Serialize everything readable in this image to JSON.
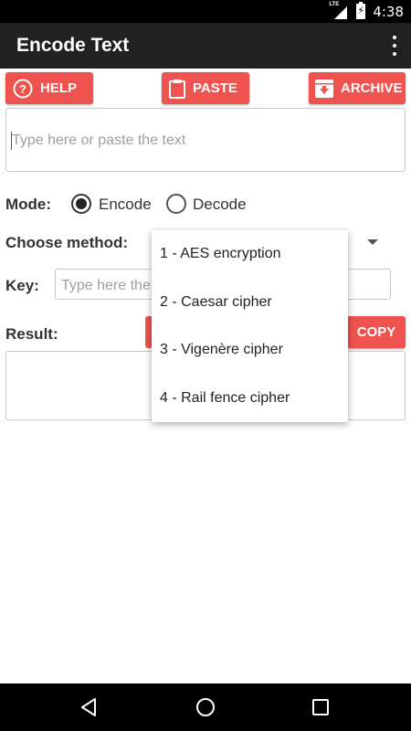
{
  "status_bar": {
    "time": "4:38",
    "network": "LTE"
  },
  "app_bar": {
    "title": "Encode Text"
  },
  "toolbar": {
    "help_label": "HELP",
    "paste_label": "PASTE",
    "archive_label": "ARCHIVE"
  },
  "input": {
    "placeholder": "Type here or paste the text"
  },
  "mode": {
    "label": "Mode:",
    "encode_label": "Encode",
    "decode_label": "Decode",
    "selected": "Encode"
  },
  "method": {
    "label": "Choose method:"
  },
  "key": {
    "label": "Key:",
    "placeholder": "Type here the"
  },
  "result": {
    "label": "Result:",
    "copy_label": "COPY"
  },
  "dropdown": {
    "items": [
      "1 - AES encryption",
      "2 - Caesar cipher",
      "3 - Vigenère cipher",
      "4 - Rail fence cipher"
    ]
  },
  "colors": {
    "accent": "#ef5350",
    "appbar": "#212121"
  }
}
